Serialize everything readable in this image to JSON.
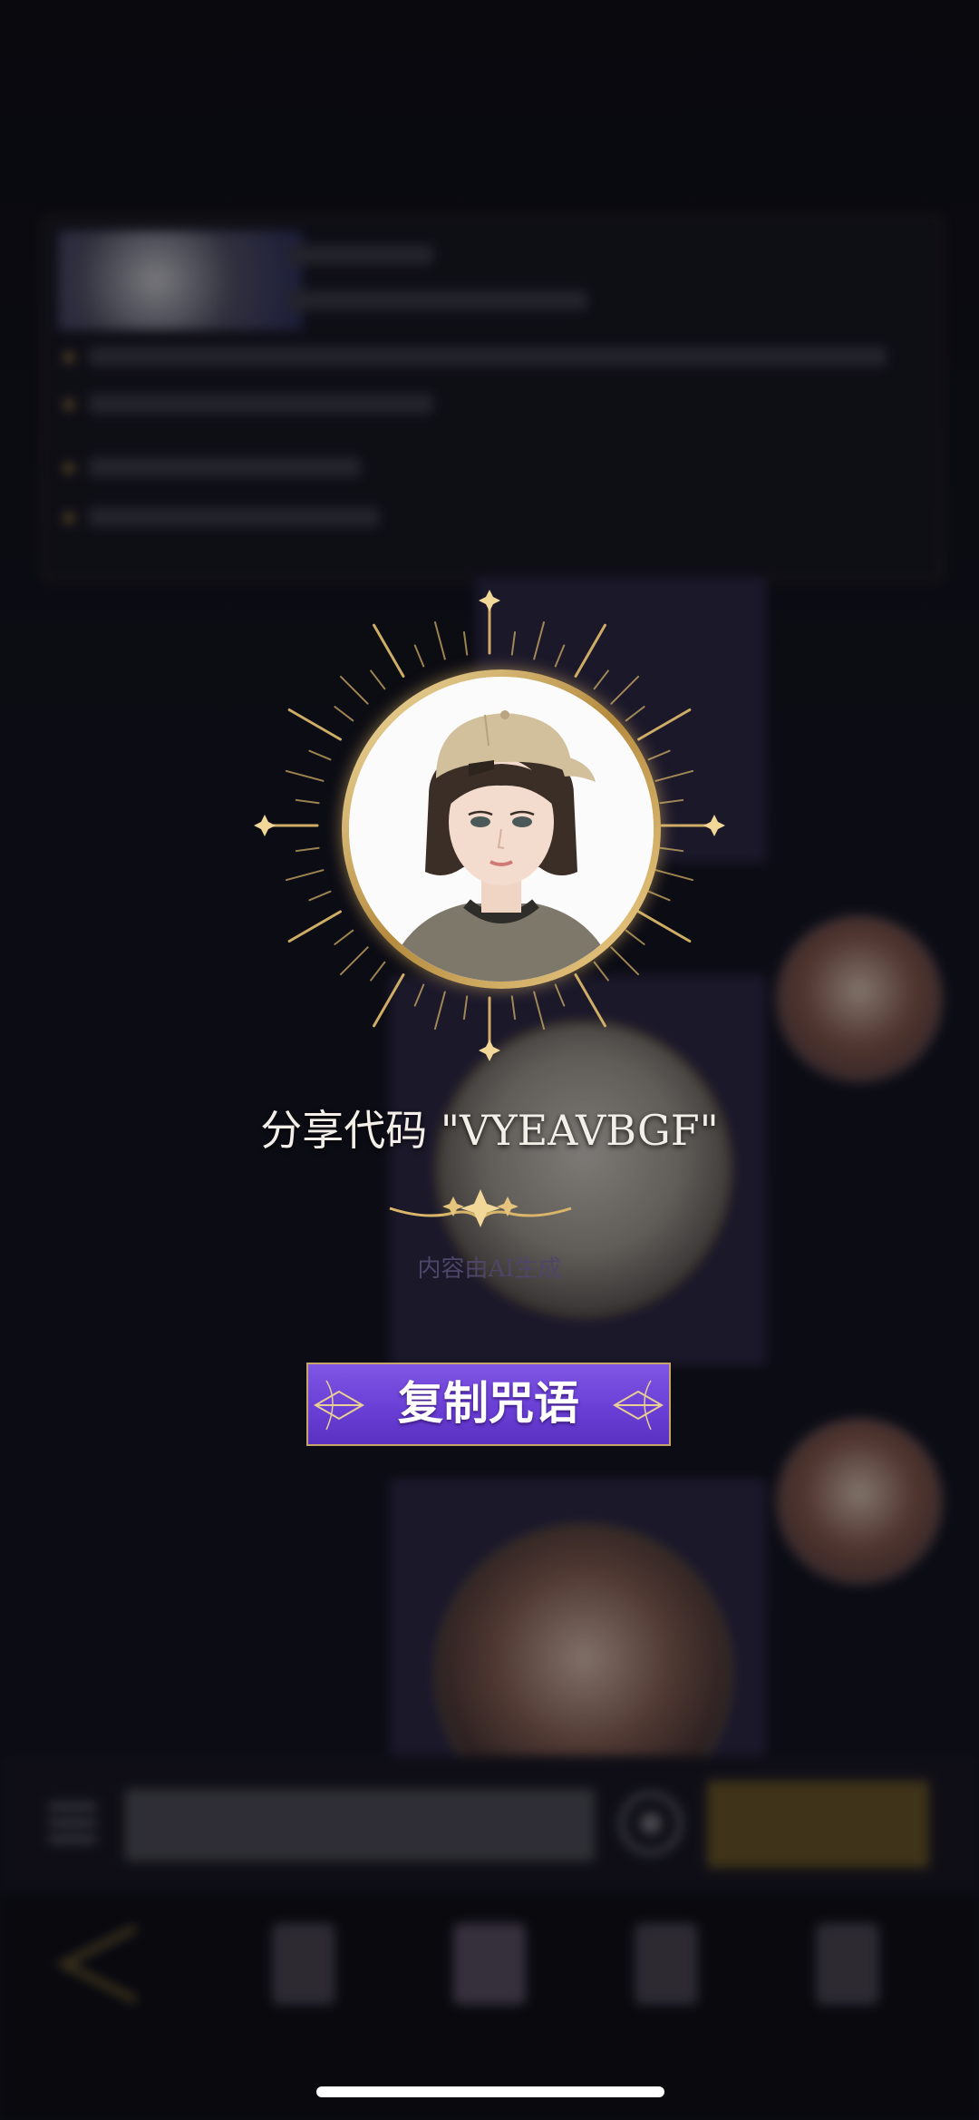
{
  "share": {
    "code_text": "分享代码 \"VYEAVBGF\"",
    "ai_notice": "内容由AI生成",
    "copy_button_label": "复制咒语"
  },
  "colors": {
    "gold": "#d9b66a",
    "button_purple": "#6a3fd6",
    "background": "#0b0b12"
  },
  "icons": {
    "back": "chevron-left-icon",
    "menu": "menu-icon",
    "emoji": "emoji-icon"
  }
}
